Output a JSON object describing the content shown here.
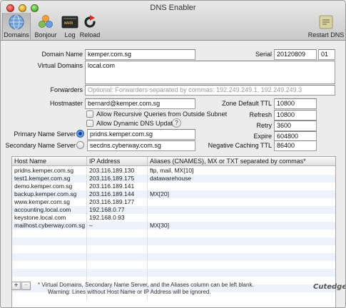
{
  "window": {
    "title": "DNS Enabler"
  },
  "toolbar": {
    "domains": "Domains",
    "bonjour": "Bonjour",
    "log": "Log",
    "reload": "Reload",
    "restart": "Restart DNS"
  },
  "form": {
    "domain_name_label": "Domain Name",
    "domain_name_value": "kemper.com.sg",
    "serial_label": "Serial",
    "serial_value": "20120809",
    "serial_rev": "01",
    "virtual_domains_label": "Virtual Domains",
    "virtual_domains_value": "local.com",
    "forwarders_label": "Forwarders",
    "forwarders_placeholder": "Optional: Forwarders separated by commas: 192.249.249.1, 192.249.249.3",
    "hostmaster_label": "Hostmaster",
    "hostmaster_value": "bernard@kemper.com.sg",
    "allow_recursive": "Allow Recursive Queries from Outside Subnet",
    "allow_dynamic": "Allow Dynamic DNS Updates",
    "help_glyph": "?",
    "primary_label": "Primary Name Server",
    "primary_value": "pridns.kemper.com.sg",
    "secondary_label": "Secondary Name Server",
    "secondary_value": "secdns.cyberway.com.sg",
    "zone_ttl_label": "Zone Default TTL",
    "zone_ttl_value": "10800",
    "refresh_label": "Refresh",
    "refresh_value": "10800",
    "retry_label": "Retry",
    "retry_value": "3600",
    "expire_label": "Expire",
    "expire_value": "604800",
    "neg_ttl_label": "Negative Caching TTL",
    "neg_ttl_value": "86400"
  },
  "table": {
    "headers": [
      "Host Name",
      "IP Address",
      "Aliases (CNAMES), MX or TXT separated by commas*"
    ],
    "rows": [
      [
        "pridns.kemper.com.sg",
        "203.116.189.130",
        "ftp, mail, MX[10]"
      ],
      [
        "test1.kemper.com.sg",
        "203.116.189.175",
        "datawarehouse"
      ],
      [
        "demo.kemper.com.sg",
        "203.116.189.141",
        ""
      ],
      [
        "backup.kemper.com.sg",
        "203.116.189.144",
        "MX[20]"
      ],
      [
        "www.kemper.com.sg",
        "203.116.189.177",
        ""
      ],
      [
        "accounting.local.com",
        "192.168.0.77",
        ""
      ],
      [
        "keystone.local.com",
        "192.168.0.93",
        ""
      ],
      [
        "mailhost.cyberway.com.sg",
        "–",
        "MX[30]"
      ]
    ]
  },
  "footer": {
    "add": "+",
    "remove": "−",
    "note1": "* Virtual Domains, Secondary Name Server, and the Aliases column can be left blank.",
    "note2": "Warning: Lines without Host Name or IP Address will be ignored.",
    "brand": "Cutedge"
  }
}
